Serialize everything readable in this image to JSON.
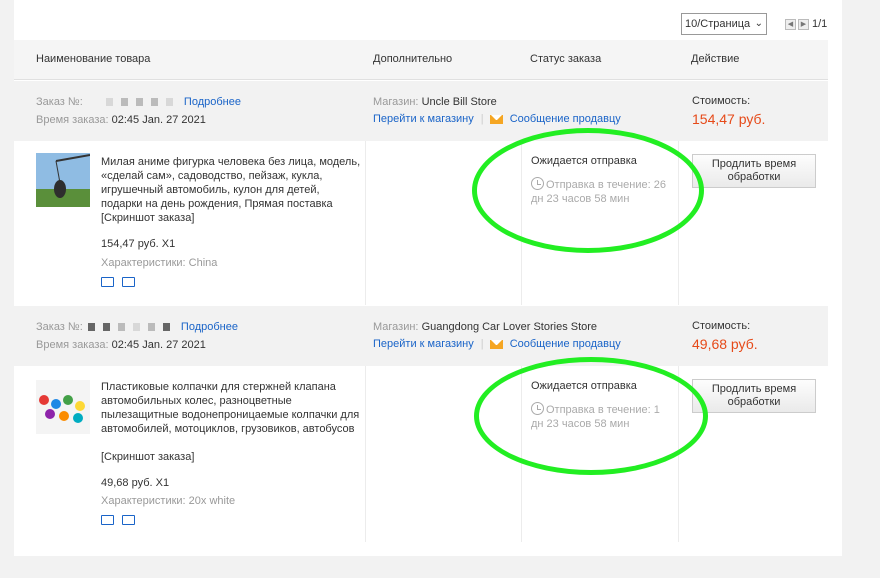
{
  "pager": {
    "per_page": "10/Страница",
    "page_count": "1/1"
  },
  "table_header": {
    "product": "Наименование товара",
    "extra": "Дополнительно",
    "status": "Статус заказа",
    "action": "Действие"
  },
  "orders": [
    {
      "order_no_label": "Заказ №:",
      "details_link": "Подробнее",
      "time_label": "Время заказа:",
      "time_value": "02:45 Jan. 27 2021",
      "store_label": "Магазин:",
      "store_name": "Uncle Bill Store",
      "go_store": "Перейти к магазину",
      "message_seller": "Сообщение продавцу",
      "cost_label": "Стоимость:",
      "cost_value": "154,47 руб.",
      "product_title": "Милая аниме фигурка человека без лица, модель, «сделай сам», садоводство, пейзаж, кукла, игрушечный автомобиль, кулон для детей, подарки на день рождения, Прямая поставка",
      "snapshot": "[Скриншот заказа]",
      "price_qty": "154,47 руб. X1",
      "specs": "Характеристики: China",
      "status_title": "Ожидается отправка",
      "status_detail": "Отправка в течение: 26 дн 23 часов 58 мин",
      "action_button": "Продлить время обработки"
    },
    {
      "order_no_label": "Заказ №:",
      "details_link": "Подробнее",
      "time_label": "Время заказа:",
      "time_value": "02:45 Jan. 27 2021",
      "store_label": "Магазин:",
      "store_name": "Guangdong Car Lover Stories Store",
      "go_store": "Перейти к магазину",
      "message_seller": "Сообщение продавцу",
      "cost_label": "Стоимость:",
      "cost_value": "49,68 руб.",
      "product_title": "Пластиковые колпачки для стержней клапана автомобильных колес, разноцветные пылезащитные водонепроницаемые колпачки для автомобилей, мотоциклов, грузовиков, автобусов",
      "snapshot": "[Скриншот заказа]",
      "price_qty": "49,68 руб. X1",
      "specs": "Характеристики: 20x white",
      "status_title": "Ожидается отправка",
      "status_detail": "Отправка в течение: 1 дн 23 часов 58 мин",
      "action_button": "Продлить время обработки"
    }
  ],
  "colors": {
    "price": "#e64a19",
    "link": "#1a64c8",
    "highlight": "#22ee22"
  }
}
